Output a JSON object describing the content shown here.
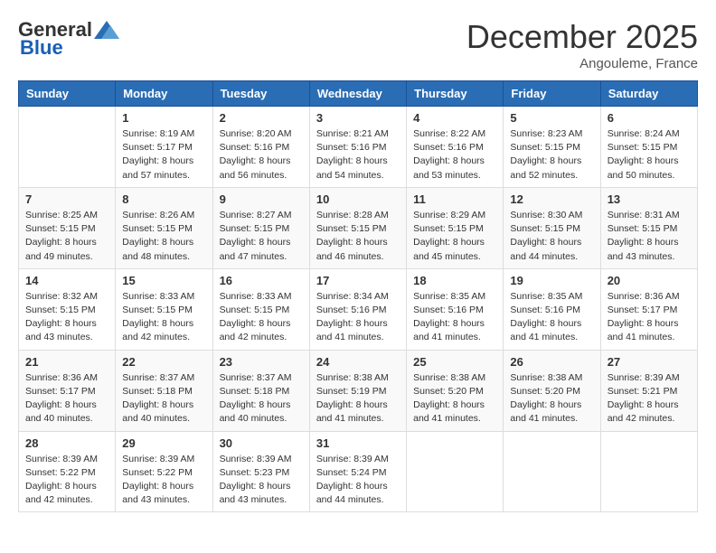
{
  "logo": {
    "general": "General",
    "blue": "Blue"
  },
  "header": {
    "month": "December 2025",
    "location": "Angouleme, France"
  },
  "weekdays": [
    "Sunday",
    "Monday",
    "Tuesday",
    "Wednesday",
    "Thursday",
    "Friday",
    "Saturday"
  ],
  "weeks": [
    [
      {
        "day": "",
        "info": ""
      },
      {
        "day": "1",
        "info": "Sunrise: 8:19 AM\nSunset: 5:17 PM\nDaylight: 8 hours\nand 57 minutes."
      },
      {
        "day": "2",
        "info": "Sunrise: 8:20 AM\nSunset: 5:16 PM\nDaylight: 8 hours\nand 56 minutes."
      },
      {
        "day": "3",
        "info": "Sunrise: 8:21 AM\nSunset: 5:16 PM\nDaylight: 8 hours\nand 54 minutes."
      },
      {
        "day": "4",
        "info": "Sunrise: 8:22 AM\nSunset: 5:16 PM\nDaylight: 8 hours\nand 53 minutes."
      },
      {
        "day": "5",
        "info": "Sunrise: 8:23 AM\nSunset: 5:15 PM\nDaylight: 8 hours\nand 52 minutes."
      },
      {
        "day": "6",
        "info": "Sunrise: 8:24 AM\nSunset: 5:15 PM\nDaylight: 8 hours\nand 50 minutes."
      }
    ],
    [
      {
        "day": "7",
        "info": "Sunrise: 8:25 AM\nSunset: 5:15 PM\nDaylight: 8 hours\nand 49 minutes."
      },
      {
        "day": "8",
        "info": "Sunrise: 8:26 AM\nSunset: 5:15 PM\nDaylight: 8 hours\nand 48 minutes."
      },
      {
        "day": "9",
        "info": "Sunrise: 8:27 AM\nSunset: 5:15 PM\nDaylight: 8 hours\nand 47 minutes."
      },
      {
        "day": "10",
        "info": "Sunrise: 8:28 AM\nSunset: 5:15 PM\nDaylight: 8 hours\nand 46 minutes."
      },
      {
        "day": "11",
        "info": "Sunrise: 8:29 AM\nSunset: 5:15 PM\nDaylight: 8 hours\nand 45 minutes."
      },
      {
        "day": "12",
        "info": "Sunrise: 8:30 AM\nSunset: 5:15 PM\nDaylight: 8 hours\nand 44 minutes."
      },
      {
        "day": "13",
        "info": "Sunrise: 8:31 AM\nSunset: 5:15 PM\nDaylight: 8 hours\nand 43 minutes."
      }
    ],
    [
      {
        "day": "14",
        "info": "Sunrise: 8:32 AM\nSunset: 5:15 PM\nDaylight: 8 hours\nand 43 minutes."
      },
      {
        "day": "15",
        "info": "Sunrise: 8:33 AM\nSunset: 5:15 PM\nDaylight: 8 hours\nand 42 minutes."
      },
      {
        "day": "16",
        "info": "Sunrise: 8:33 AM\nSunset: 5:15 PM\nDaylight: 8 hours\nand 42 minutes."
      },
      {
        "day": "17",
        "info": "Sunrise: 8:34 AM\nSunset: 5:16 PM\nDaylight: 8 hours\nand 41 minutes."
      },
      {
        "day": "18",
        "info": "Sunrise: 8:35 AM\nSunset: 5:16 PM\nDaylight: 8 hours\nand 41 minutes."
      },
      {
        "day": "19",
        "info": "Sunrise: 8:35 AM\nSunset: 5:16 PM\nDaylight: 8 hours\nand 41 minutes."
      },
      {
        "day": "20",
        "info": "Sunrise: 8:36 AM\nSunset: 5:17 PM\nDaylight: 8 hours\nand 41 minutes."
      }
    ],
    [
      {
        "day": "21",
        "info": "Sunrise: 8:36 AM\nSunset: 5:17 PM\nDaylight: 8 hours\nand 40 minutes."
      },
      {
        "day": "22",
        "info": "Sunrise: 8:37 AM\nSunset: 5:18 PM\nDaylight: 8 hours\nand 40 minutes."
      },
      {
        "day": "23",
        "info": "Sunrise: 8:37 AM\nSunset: 5:18 PM\nDaylight: 8 hours\nand 40 minutes."
      },
      {
        "day": "24",
        "info": "Sunrise: 8:38 AM\nSunset: 5:19 PM\nDaylight: 8 hours\nand 41 minutes."
      },
      {
        "day": "25",
        "info": "Sunrise: 8:38 AM\nSunset: 5:20 PM\nDaylight: 8 hours\nand 41 minutes."
      },
      {
        "day": "26",
        "info": "Sunrise: 8:38 AM\nSunset: 5:20 PM\nDaylight: 8 hours\nand 41 minutes."
      },
      {
        "day": "27",
        "info": "Sunrise: 8:39 AM\nSunset: 5:21 PM\nDaylight: 8 hours\nand 42 minutes."
      }
    ],
    [
      {
        "day": "28",
        "info": "Sunrise: 8:39 AM\nSunset: 5:22 PM\nDaylight: 8 hours\nand 42 minutes."
      },
      {
        "day": "29",
        "info": "Sunrise: 8:39 AM\nSunset: 5:22 PM\nDaylight: 8 hours\nand 43 minutes."
      },
      {
        "day": "30",
        "info": "Sunrise: 8:39 AM\nSunset: 5:23 PM\nDaylight: 8 hours\nand 43 minutes."
      },
      {
        "day": "31",
        "info": "Sunrise: 8:39 AM\nSunset: 5:24 PM\nDaylight: 8 hours\nand 44 minutes."
      },
      {
        "day": "",
        "info": ""
      },
      {
        "day": "",
        "info": ""
      },
      {
        "day": "",
        "info": ""
      }
    ]
  ]
}
